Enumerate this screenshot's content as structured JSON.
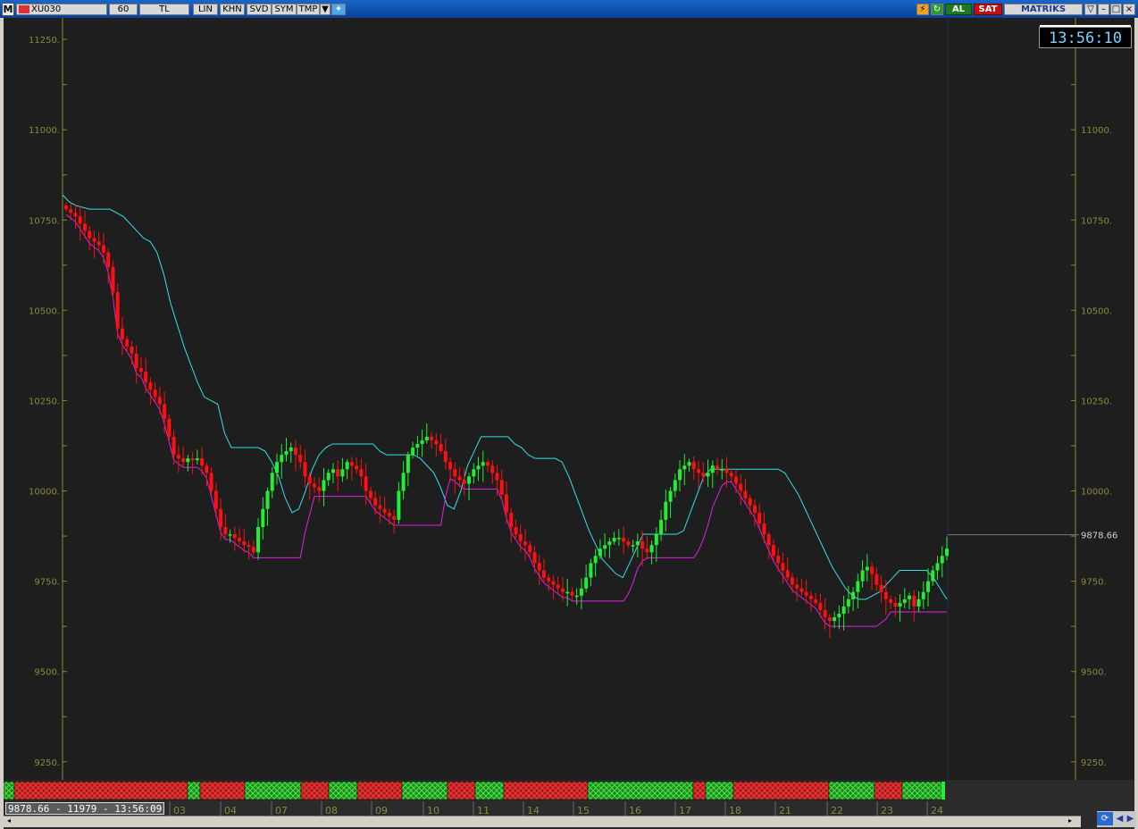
{
  "toolbar": {
    "menu_label": "M",
    "symbol": "XU030",
    "period": "60",
    "currency": "TL",
    "buttons": [
      "LIN",
      "KHN",
      "SVD",
      "SYM",
      "TMP"
    ],
    "buy_label": "AL",
    "sell_label": "SAT",
    "brand": "MATRIKS",
    "colors": {
      "buy": "#1f7a1f",
      "sell": "#c01010",
      "titlebar": "#0b4fb0"
    }
  },
  "clock": "13:56:10",
  "status_text": "9878.66 - 11979 - 13:56:09",
  "price_marker": "9878.66",
  "chart_data": {
    "type": "candlestick",
    "title": "",
    "y_ticks": [
      9250,
      9500,
      9750,
      10000,
      10250,
      10500,
      10750,
      11000,
      11250
    ],
    "y_tick_labels": [
      "9250.",
      "9500.",
      "9750.",
      "10000.",
      "10250.",
      "10500.",
      "10750.",
      "11000.",
      "11250."
    ],
    "ylim": [
      9200,
      11280
    ],
    "x_labels": [
      "03",
      "04",
      "07",
      "08",
      "09",
      "10",
      "11",
      "14",
      "15",
      "16",
      "17",
      "18",
      "21",
      "22",
      "23",
      "24"
    ],
    "last_price": 9878.66,
    "grid": false,
    "colors": {
      "up": "#22ee33",
      "down": "#ff1010",
      "upper_band": "#33e0e8",
      "lower_band": "#e020e0",
      "axis": "#8a8a2a",
      "bg": "#1e1e1e"
    },
    "closes": [
      10780,
      10770,
      10760,
      10740,
      10720,
      10700,
      10690,
      10680,
      10660,
      10620,
      10550,
      10450,
      10420,
      10400,
      10380,
      10340,
      10330,
      10300,
      10280,
      10260,
      10240,
      10200,
      10150,
      10100,
      10090,
      10080,
      10090,
      10085,
      10090,
      10070,
      10050,
      10000,
      9950,
      9900,
      9880,
      9880,
      9870,
      9860,
      9850,
      9845,
      9830,
      9900,
      9950,
      10000,
      10050,
      10080,
      10100,
      10110,
      10120,
      10100,
      10080,
      10040,
      10020,
      10010,
      10000,
      10030,
      10050,
      10060,
      10040,
      10060,
      10080,
      10070,
      10060,
      10040,
      10000,
      9980,
      9960,
      9950,
      9940,
      9930,
      9920,
      10000,
      10050,
      10100,
      10120,
      10130,
      10140,
      10150,
      10140,
      10130,
      10110,
      10080,
      10060,
      10040,
      10030,
      10020,
      10040,
      10060,
      10070,
      10080,
      10070,
      10050,
      10030,
      9990,
      9940,
      9900,
      9880,
      9860,
      9850,
      9830,
      9800,
      9780,
      9760,
      9750,
      9740,
      9730,
      9720,
      9720,
      9710,
      9710,
      9730,
      9760,
      9800,
      9820,
      9840,
      9850,
      9860,
      9870,
      9870,
      9860,
      9850,
      9850,
      9860,
      9840,
      9830,
      9850,
      9880,
      9920,
      9970,
      10000,
      10030,
      10060,
      10070,
      10080,
      10060,
      10050,
      10040,
      10050,
      10070,
      10060,
      10060,
      10050,
      10040,
      10020,
      10000,
      9980,
      9960,
      9940,
      9910,
      9880,
      9850,
      9820,
      9800,
      9780,
      9760,
      9740,
      9730,
      9720,
      9710,
      9700,
      9690,
      9670,
      9650,
      9640,
      9650,
      9660,
      9680,
      9700,
      9720,
      9750,
      9780,
      9790,
      9770,
      9740,
      9720,
      9700,
      9690,
      9680,
      9690,
      9700,
      9710,
      9680,
      9700,
      9720,
      9750,
      9780,
      9800,
      9820,
      9840
    ],
    "upper_band": [
      10820,
      10800,
      10790,
      10785,
      10780,
      10780,
      10780,
      10780,
      10770,
      10760,
      10740,
      10720,
      10700,
      10690,
      10660,
      10600,
      10520,
      10460,
      10400,
      10350,
      10300,
      10260,
      10250,
      10240,
      10160,
      10120,
      10120,
      10120,
      10120,
      10120,
      10110,
      10080,
      10040,
      9980,
      9940,
      9950,
      10000,
      10060,
      10100,
      10120,
      10130,
      10130,
      10130,
      10130,
      10130,
      10130,
      10130,
      10110,
      10100,
      10100,
      10100,
      10100,
      10100,
      10090,
      10070,
      10050,
      10010,
      9960,
      9950,
      10000,
      10070,
      10110,
      10150,
      10150,
      10150,
      10150,
      10150,
      10130,
      10120,
      10100,
      10090,
      10090,
      10090,
      10090,
      10080,
      10040,
      9990,
      9940,
      9890,
      9850,
      9810,
      9790,
      9770,
      9760,
      9800,
      9840,
      9880,
      9880,
      9880,
      9880,
      9880,
      9880,
      9890,
      9940,
      9990,
      10040,
      10060,
      10060,
      10060,
      10060,
      10060,
      10060,
      10060,
      10060,
      10060,
      10060,
      10060,
      10050,
      10020,
      9990,
      9950,
      9910,
      9870,
      9830,
      9790,
      9760,
      9730,
      9710,
      9700,
      9700,
      9710,
      9720,
      9740,
      9760,
      9780,
      9780,
      9780,
      9780,
      9780,
      9760,
      9730,
      9700
    ]
  }
}
